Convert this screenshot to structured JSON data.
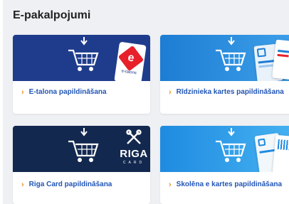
{
  "section": {
    "title": "E-pakalpojumi"
  },
  "cards": [
    {
      "caption": "E-talona papildināšana",
      "chevron": "›",
      "badge": "e",
      "badge_sub": "e-talons"
    },
    {
      "caption": "Rīdzinieka kartes papildināšana",
      "chevron": "›"
    },
    {
      "caption": "Riga Card papildināšana",
      "chevron": "›",
      "logo_text": "RIGA",
      "logo_sub": "CARD"
    },
    {
      "caption": "Skolēna e kartes papildināšana",
      "chevron": "›"
    }
  ],
  "colors": {
    "card1": "#1f3c8c",
    "card2": "#1d7dd3",
    "card3": "#13284f",
    "card4": "#1f8be0",
    "link": "#2155b5",
    "chevron": "#e8921e",
    "etalons_badge": "#e8202a"
  },
  "icons": [
    "shopping-cart-icon",
    "arrow-down-icon",
    "e-talons-card-icon",
    "riga-card-logo-icon",
    "riga-resident-card-icon",
    "pupil-card-icon"
  ]
}
